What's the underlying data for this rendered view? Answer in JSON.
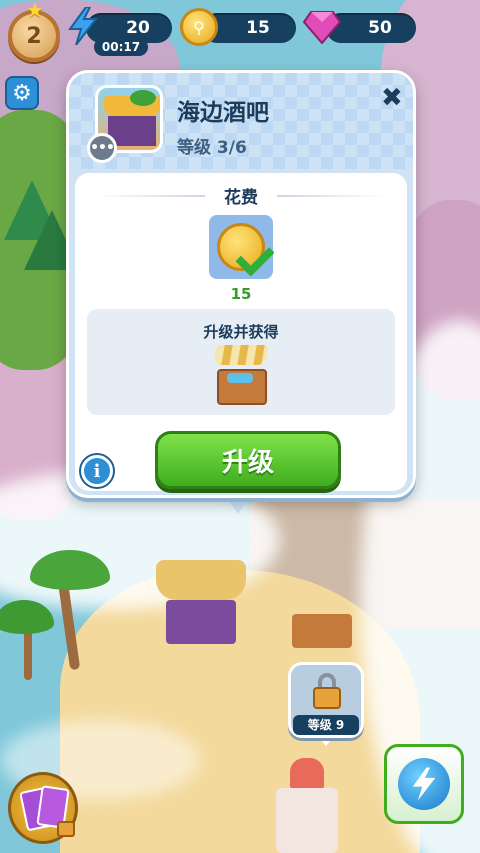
{
  "topbar": {
    "player_level": "2",
    "energy": {
      "value": "20",
      "timer": "00:17",
      "icon": "lightning-icon"
    },
    "coins": {
      "value": "15",
      "icon": "coin-icon"
    },
    "gems": {
      "value": "50",
      "icon": "gem-icon"
    },
    "settings_icon": "gear-icon"
  },
  "popup": {
    "title": "海边酒吧",
    "level": "等级 3/6",
    "close_icon": "close-icon",
    "chat_icon": "chat-icon",
    "cost_title": "花费",
    "cost_value": "15",
    "reward_title": "升级并获得",
    "upgrade_label": "升级",
    "info_label": "i"
  },
  "lock_bubble": {
    "label": "等级 9",
    "icon": "padlock-icon"
  },
  "bottom": {
    "cards_icon": "cards-icon",
    "energy_shop_icon": "lightning-icon"
  },
  "colors": {
    "popup_bg": "#cfe3f5",
    "upgrade_green": "#3fae1e",
    "resource_bar": "#173f5f",
    "accent_blue": "#2d8fd6"
  }
}
